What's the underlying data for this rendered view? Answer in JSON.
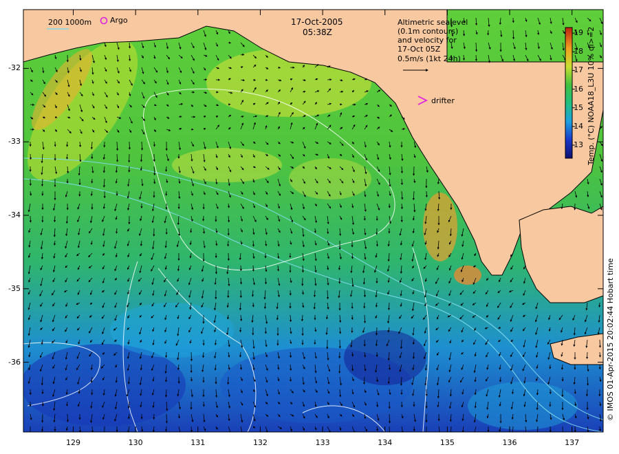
{
  "title": {
    "date": "17-Oct-2005",
    "time": "05:38Z"
  },
  "legend": {
    "depth_contours": "200  1000m",
    "argo": "Argo",
    "drifter": "drifter",
    "velocity_note": [
      "Altimetric sealevel",
      "(0.1m contours)",
      "and velocity for",
      "17-Oct 05Z",
      "0.5m/s (1kt 24h)"
    ]
  },
  "colorbar": {
    "label": "Temp. (°C) NOAA18_L3U 10% ql>=2",
    "ticks": [
      13,
      14,
      15,
      16,
      17,
      18,
      19
    ],
    "range": [
      12.3,
      19.3
    ]
  },
  "axes": {
    "lon_ticks": [
      129,
      130,
      131,
      132,
      133,
      134,
      135,
      136,
      137
    ],
    "lat_ticks": [
      -32,
      -33,
      -34,
      -35,
      -36
    ],
    "lon_range": [
      128.2,
      137.5
    ],
    "lat_range": [
      -36.95,
      -31.2
    ]
  },
  "credit": "© IMOS 01-Apr-2015 20:02:44 Hobart time",
  "colors": {
    "land": "#f8c9a0",
    "contour": "#ffffff",
    "isobath": "#7fd8e8",
    "argo": "#e020e0",
    "drifter": "#e020e0",
    "arrow": "#000000"
  }
}
